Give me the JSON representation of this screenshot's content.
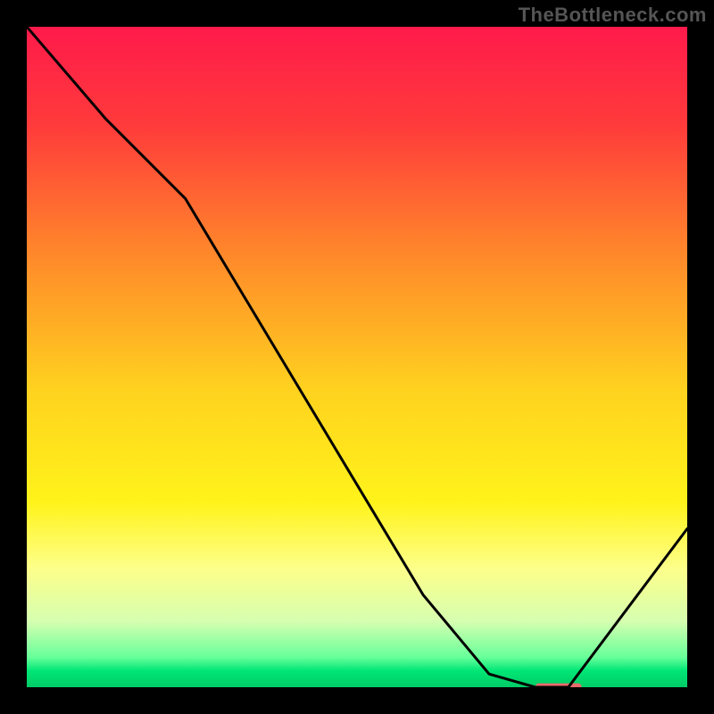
{
  "watermark": "TheBottleneck.com",
  "chart_data": {
    "type": "line",
    "title": "",
    "xlabel": "",
    "ylabel": "",
    "xlim": [
      0,
      100
    ],
    "ylim": [
      0,
      100
    ],
    "background_gradient": {
      "stops": [
        {
          "offset": 0.0,
          "color": "#ff1a4b"
        },
        {
          "offset": 0.15,
          "color": "#ff3b3b"
        },
        {
          "offset": 0.35,
          "color": "#ff8a2a"
        },
        {
          "offset": 0.55,
          "color": "#ffd21f"
        },
        {
          "offset": 0.72,
          "color": "#fff31a"
        },
        {
          "offset": 0.82,
          "color": "#fdff8a"
        },
        {
          "offset": 0.9,
          "color": "#d6ffb0"
        },
        {
          "offset": 0.955,
          "color": "#66ff99"
        },
        {
          "offset": 0.975,
          "color": "#00e676"
        },
        {
          "offset": 1.0,
          "color": "#00cc66"
        }
      ]
    },
    "series": [
      {
        "name": "bottleneck-curve",
        "color": "#000000",
        "width": 3,
        "x": [
          0,
          12,
          24,
          60,
          70,
          77,
          82,
          100
        ],
        "y": [
          100,
          86,
          74,
          14,
          2,
          0,
          0,
          24
        ]
      }
    ],
    "marker": {
      "name": "optimal-range",
      "color": "#e86a6a",
      "x_start": 77,
      "x_end": 84,
      "y": 0,
      "height": 1.2
    }
  }
}
